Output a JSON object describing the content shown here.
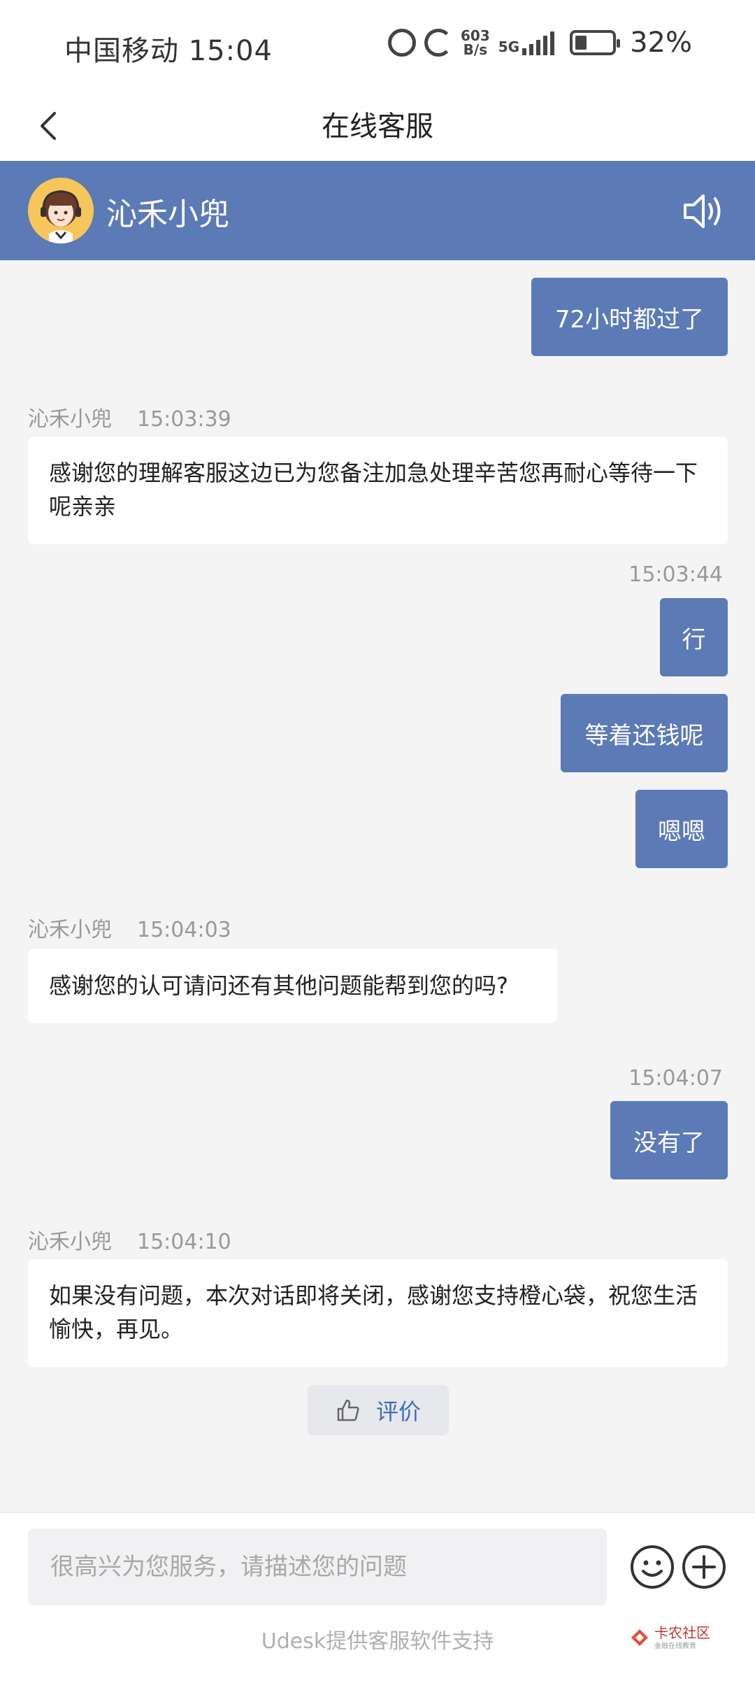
{
  "status_bar": {
    "carrier_time": "中国移动 15:04",
    "net_speed_value": "603",
    "net_speed_unit": "B/s",
    "network": "5G",
    "battery_percent": "32%",
    "battery_level": 0.32
  },
  "title_bar": {
    "title": "在线客服",
    "back_icon": "chevron-left-icon"
  },
  "agent": {
    "name": "沁禾小兜",
    "speaker_icon": "speaker-icon",
    "accent_color": "#5b7ab6"
  },
  "messages": [
    {
      "from": "user",
      "text": "72小时都过了"
    },
    {
      "from": "agent",
      "sender": "沁禾小兜",
      "time": "15:03:39",
      "text": "感谢您的理解客服这边已为您备注加急处理辛苦您再耐心等待一下呢亲亲"
    },
    {
      "from": "time",
      "time": "15:03:44"
    },
    {
      "from": "user",
      "text": "行"
    },
    {
      "from": "user",
      "text": "等着还钱呢"
    },
    {
      "from": "user",
      "text": "嗯嗯"
    },
    {
      "from": "agent",
      "sender": "沁禾小兜",
      "time": "15:04:03",
      "text": "感谢您的认可请问还有其他问题能帮到您的吗?"
    },
    {
      "from": "time",
      "time": "15:04:07"
    },
    {
      "from": "user",
      "text": "没有了"
    },
    {
      "from": "agent",
      "sender": "沁禾小兜",
      "time": "15:04:10",
      "text": "如果没有问题，本次对话即将关闭，感谢您支持橙心袋，祝您生活愉快，再见。"
    }
  ],
  "rating": {
    "label": "评价",
    "icon": "thumbs-up-icon"
  },
  "composer": {
    "placeholder": "很高兴为您服务，请描述您的问题",
    "value": "",
    "emoji_icon": "emoji-icon",
    "plus_icon": "plus-icon"
  },
  "footer": {
    "note": "Udesk提供客服软件支持"
  },
  "watermark": {
    "title": "卡农社区",
    "subtitle": "金融在线教育"
  }
}
